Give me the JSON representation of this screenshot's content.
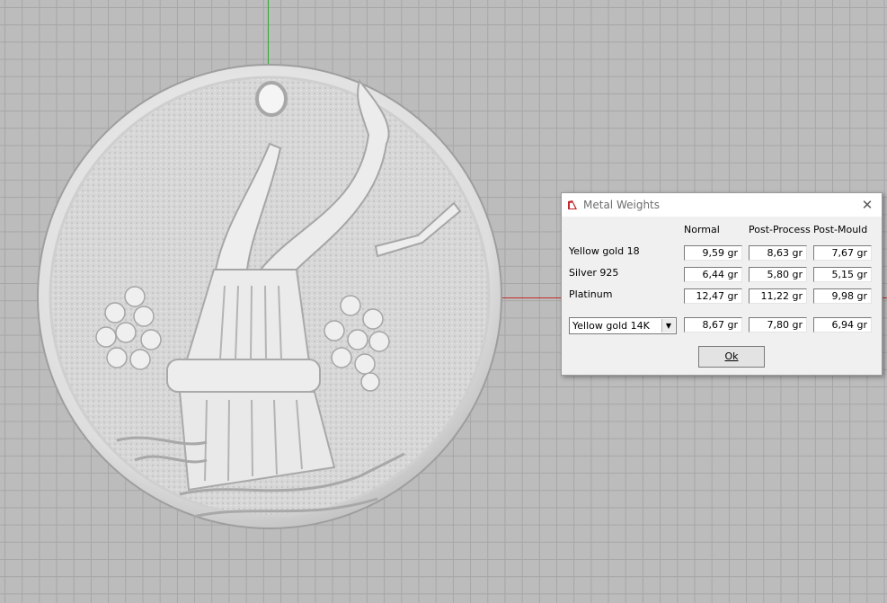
{
  "dialog": {
    "title": "Metal Weights",
    "columns": [
      "Normal",
      "Post-Process",
      "Post-Mould"
    ],
    "rows": [
      {
        "label": "Yellow gold 18",
        "values": [
          "9,59 gr",
          "8,63 gr",
          "7,67 gr"
        ]
      },
      {
        "label": "Silver 925",
        "values": [
          "6,44 gr",
          "5,80 gr",
          "5,15 gr"
        ]
      },
      {
        "label": "Platinum",
        "values": [
          "12,47 gr",
          "11,22 gr",
          "9,98 gr"
        ]
      }
    ],
    "custom_row": {
      "selected_metal": "Yellow gold 14K",
      "values": [
        "8,67 gr",
        "7,80 gr",
        "6,94 gr"
      ]
    },
    "ok_label": "Ok"
  },
  "colors": {
    "grid_background": "#bcbcbc",
    "grid_line": "#a6a6a6",
    "y_axis": "#2fa82f",
    "x_axis": "#c22b2b",
    "model": "#e3e3e3"
  },
  "icons": {
    "dialog_app": "app-icon",
    "close": "close-icon",
    "dropdown": "chevron-down-icon"
  }
}
